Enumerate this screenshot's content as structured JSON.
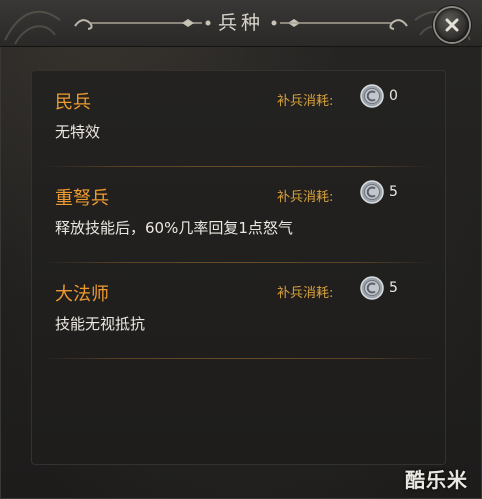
{
  "dialog": {
    "title": "兵种",
    "close_icon": "close-icon"
  },
  "units": [
    {
      "name": "民兵",
      "description": "无特效",
      "cost_label": "补兵消耗:",
      "cost_icon": "silver-coin-icon",
      "cost": "0"
    },
    {
      "name": "重弩兵",
      "description": "释放技能后，60%几率回复1点怒气",
      "cost_label": "补兵消耗:",
      "cost_icon": "silver-coin-icon",
      "cost": "5"
    },
    {
      "name": "大法师",
      "description": "技能无视抵抗",
      "cost_label": "补兵消耗:",
      "cost_icon": "silver-coin-icon",
      "cost": "5"
    }
  ],
  "watermark": "酷乐米",
  "colors": {
    "unit_name": "#ef9a2f",
    "cost_label": "#d9a13c",
    "text": "#ece8e1"
  }
}
